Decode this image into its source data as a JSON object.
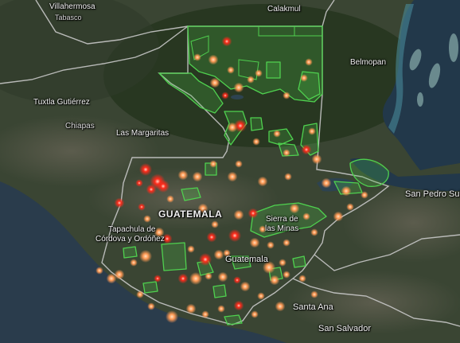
{
  "map": {
    "country_label": "GUATEMALA",
    "place_labels": {
      "villahermosa": "Villahermosa",
      "tabasco": "Tabasco",
      "calakmul": "Calakmul",
      "belmopan": "Belmopan",
      "tuxtla": "Tuxtla Gutiérrez",
      "chiapas": "Chiapas",
      "las_margaritas": "Las Margaritas",
      "san_pedro_sula": "San Pedro Sul",
      "sierra_de_las_minas_1": "Sierra de",
      "sierra_de_las_minas_2": "las Minas",
      "tapachula_1": "Tapachula de",
      "tapachula_2": "Córdova y Ordóñez",
      "guatemala_city": "Guatemala",
      "santa_ana": "Santa Ana",
      "san_salvador": "San Salvador"
    },
    "colors": {
      "land": "#3a4533",
      "forest": "#26351f",
      "sea": "#2a3c4c",
      "border": "#c8c8c8",
      "protected_area": "#4fd14f",
      "fire_hotspot_high": "#ff2a1a",
      "fire_hotspot_low": "#ff9a55"
    }
  }
}
